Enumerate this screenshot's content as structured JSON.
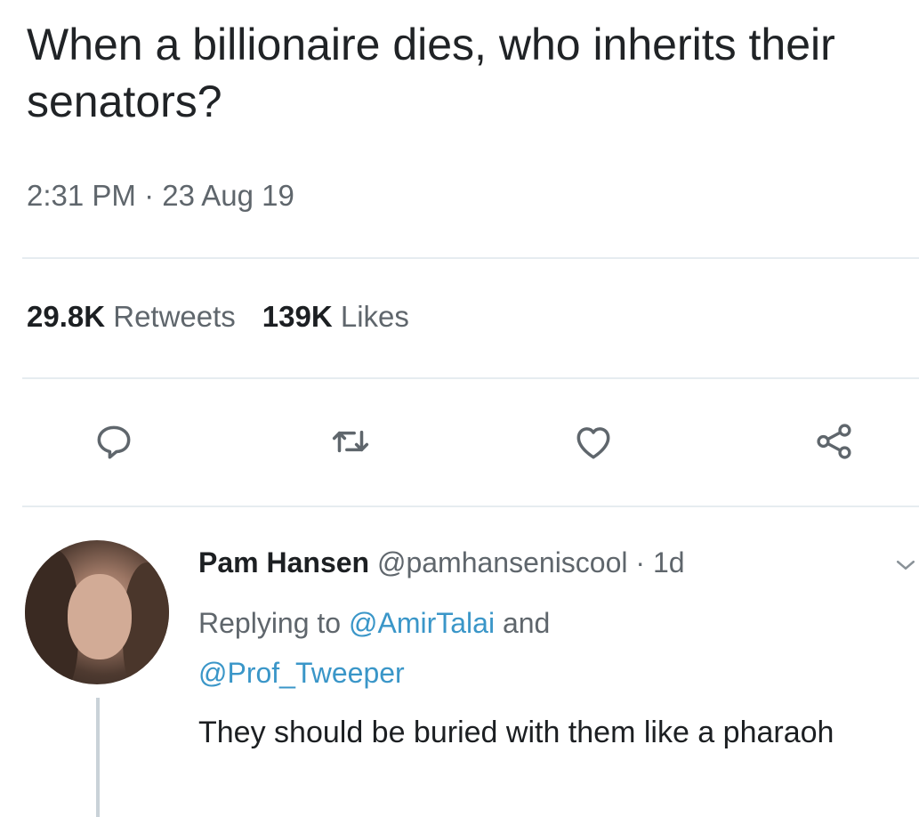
{
  "tweet": {
    "text": "When a billionaire dies, who inherits their senators?",
    "timestamp": "2:31 PM · 23 Aug 19"
  },
  "stats": {
    "retweets_count": "29.8K",
    "retweets_label": "Retweets",
    "likes_count": "139K",
    "likes_label": "Likes"
  },
  "actions": {
    "icons": [
      "reply-icon",
      "retweet-icon",
      "like-icon",
      "share-icon"
    ],
    "icon_color": "#5f666c"
  },
  "reply": {
    "name": "Pam Hansen",
    "handle": "@pamhanseniscool",
    "time": "· 1d",
    "replying_prefix": "Replying to",
    "mention_1": "@AmirTalai",
    "replying_and": "and",
    "mention_2": "@Prof_Tweeper",
    "text": "They should be buried with them like a pharaoh"
  },
  "colors": {
    "text_primary": "#1c1f22",
    "text_secondary": "#5f666c",
    "mention": "#3a96c8",
    "divider": "#e6ecf0"
  }
}
